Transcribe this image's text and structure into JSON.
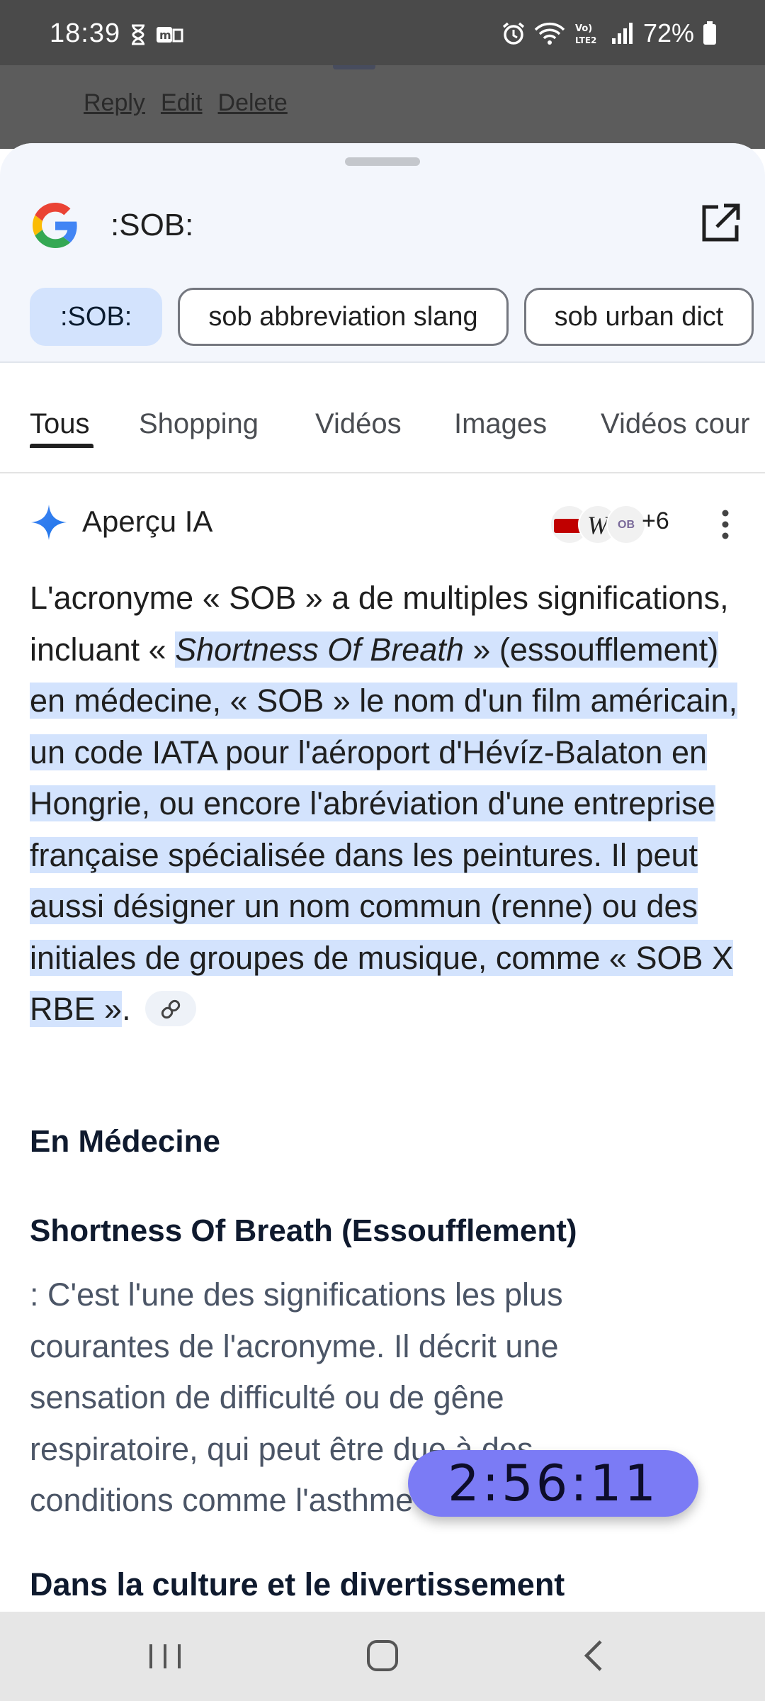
{
  "status_bar": {
    "time": "18:39",
    "battery": "72%",
    "icons": [
      "hourglass-icon",
      "message-icon",
      "alarm-icon",
      "wifi-icon",
      "volte-icon",
      "signal-icon",
      "battery-icon"
    ]
  },
  "background_page": {
    "links": [
      "Reply",
      "Edit",
      "Delete"
    ]
  },
  "search": {
    "query": ":SOB:",
    "chips": [
      ":SOB:",
      "sob abbreviation slang",
      "sob urban dict"
    ]
  },
  "tabs": [
    "Tous",
    "Shopping",
    "Vidéos",
    "Images",
    "Vidéos cour"
  ],
  "ai_overview": {
    "title": "Aperçu IA",
    "sources_more": "+6",
    "intro_plain": "L'acronyme « SOB » a de multiples significations, incluant « ",
    "intro_term": "Shortness Of Breath",
    "intro_rest": " » (essoufflement) en médecine, « SOB » le nom d'un film américain, un code IATA pour l'aéroport d'Hévíz-Balaton en Hongrie, ou encore l'abréviation d'une entreprise française spécialisée dans les peintures. Il peut aussi désigner un nom commun (renne) ou des initiales de groupes de musique, comme « SOB X RBE »",
    "intro_end": ".",
    "section_medicine": "En Médecine",
    "sob_heading": "Shortness Of Breath (Essoufflement)",
    "sob_description": ": C'est l'une des significations les plus courantes de l'acronyme. Il décrit une sensation de difficulté ou de gêne respiratoire, qui peut être due à des conditions comme l'asthme",
    "section_culture": "Dans la culture et le divertissement"
  },
  "timer": "2:56:11",
  "colors": {
    "highlight": "#d3e3fd",
    "timer": "#7b7bf5",
    "google_blue": "#4285f4",
    "google_red": "#ea4335",
    "google_yellow": "#fbbc05",
    "google_green": "#34a853"
  }
}
